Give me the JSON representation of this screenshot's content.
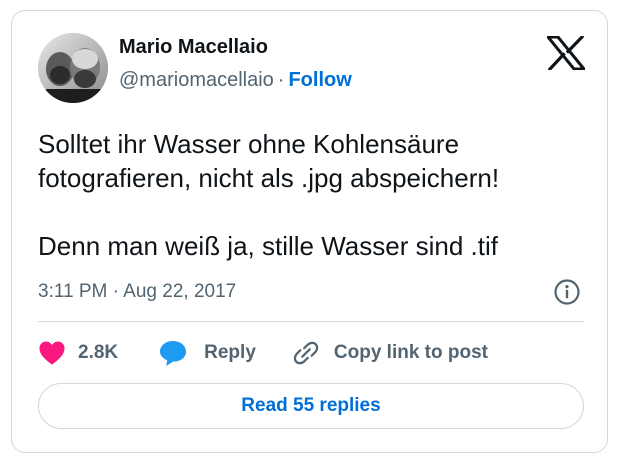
{
  "author": {
    "name": "Mario Macellaio",
    "handle": "@mariomacellaio",
    "separator": "·",
    "follow_label": "Follow"
  },
  "tweet": {
    "lines_paragraph1": [
      "Solltet ihr Wasser ohne Kohlensäure",
      "fotografieren, nicht als .jpg abspeichern!"
    ],
    "paragraph2": "Denn man weiß ja, stille Wasser sind .tif",
    "timestamp": "3:11 PM · Aug 22, 2017"
  },
  "actions": {
    "like_count": "2.8K",
    "reply_label": "Reply",
    "copy_link_label": "Copy link to post"
  },
  "read_replies_label": "Read 55 replies",
  "icons": {
    "logo": "x-logo-icon",
    "info": "info-icon",
    "like": "heart-icon",
    "reply": "speech-bubble-icon",
    "copy": "link-icon"
  },
  "colors": {
    "link_blue": "#006fd6",
    "like_pink": "#f91880",
    "reply_blue": "#1d9bf0",
    "text_primary": "#0f1419",
    "text_secondary": "#536471",
    "border": "#cfd9de"
  }
}
